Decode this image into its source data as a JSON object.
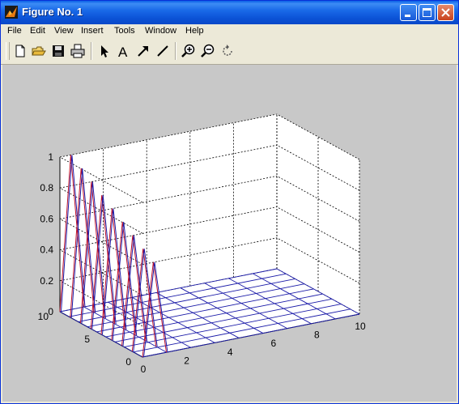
{
  "window": {
    "title": "Figure No. 1"
  },
  "menu": [
    "File",
    "Edit",
    "View",
    "Insert",
    "Tools",
    "Window",
    "Help"
  ],
  "toolbar": {
    "icons": [
      "new-file-icon",
      "open-folder-icon",
      "save-icon",
      "print-icon",
      "arrow-select-icon",
      "insert-text-icon",
      "insert-arrow-icon",
      "insert-line-icon",
      "zoom-in-icon",
      "zoom-out-icon",
      "rotate-3d-icon"
    ]
  },
  "colors": {
    "titlebar": "#0a5fe6",
    "canvas": "#c8c8c8",
    "axes_background": "#ffffff",
    "mesh": "#1a1aa8",
    "mesh_highlight": "#c0142c"
  },
  "chart_data": {
    "type": "mesh3d",
    "xticks": [
      "0",
      "2",
      "4",
      "6",
      "8",
      "10"
    ],
    "yticks": [
      "0",
      "5",
      "10"
    ],
    "zticks": [
      "0",
      "0.2",
      "0.4",
      "0.6",
      "0.8",
      "1"
    ],
    "xlim": [
      0,
      10
    ],
    "ylim": [
      0,
      10
    ],
    "zlim": [
      0,
      1
    ],
    "grid": true,
    "box": true,
    "base_grid_lines": 9,
    "peak": {
      "x": 0.5,
      "y_range": [
        0,
        10
      ],
      "z_start": 0.6,
      "z_end": 1.0,
      "line_count": 9
    }
  }
}
